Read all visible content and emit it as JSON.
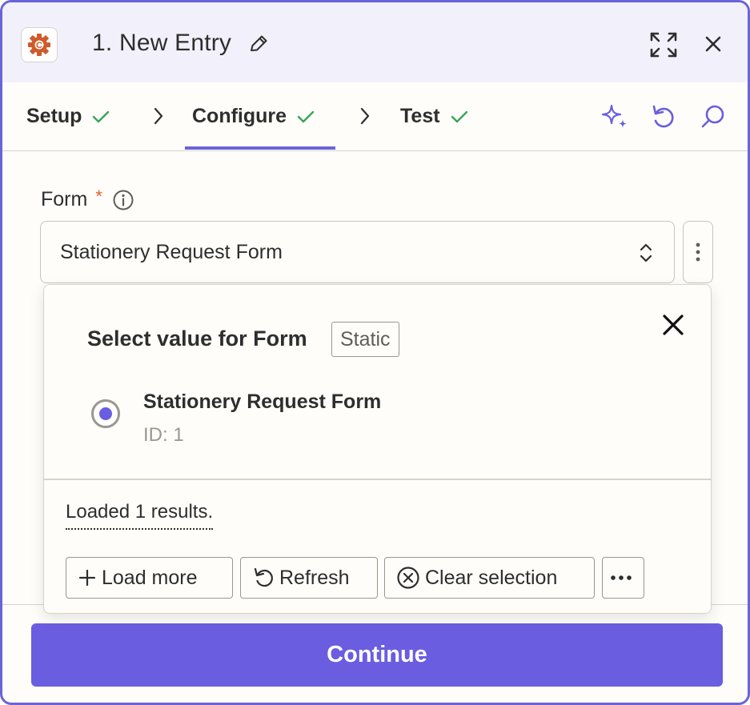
{
  "header": {
    "title": "1. New Entry",
    "icons": [
      "cog-app-icon",
      "pencil-icon",
      "expand-icon",
      "close-icon"
    ]
  },
  "tabs": [
    {
      "label": "Setup",
      "complete": true
    },
    {
      "label": "Configure",
      "complete": true,
      "active": true
    },
    {
      "label": "Test",
      "complete": true
    }
  ],
  "toolbar_icons": [
    "ai-sparkle-icon",
    "undo-icon",
    "search-icon"
  ],
  "field": {
    "label": "Form",
    "required_mark": "*",
    "selected_value": "Stationery Request Form"
  },
  "popup": {
    "title": "Select value for Form",
    "badge": "Static",
    "options": [
      {
        "title": "Stationery Request Form",
        "subtitle": "ID: 1",
        "selected": true
      }
    ],
    "loaded_text": "Loaded 1 results.",
    "buttons": {
      "load_more": "Load more",
      "refresh": "Refresh",
      "clear": "Clear selection"
    }
  },
  "footer": {
    "continue_label": "Continue"
  },
  "colors": {
    "accent": "#6a5de0",
    "check": "#3aa35b",
    "required": "#e35d2a",
    "app_icon": "#d15a2a"
  }
}
